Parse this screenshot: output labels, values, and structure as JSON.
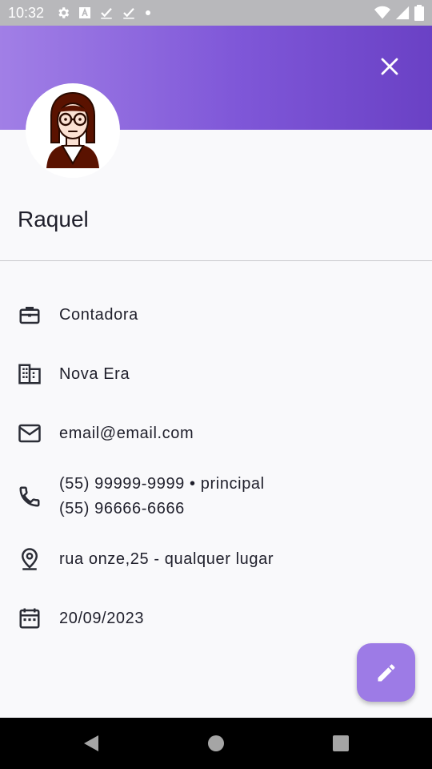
{
  "status_bar": {
    "time": "10:32",
    "background": "#b8b8bb"
  },
  "header": {
    "gradient_start": "#a17fe6",
    "gradient_end": "#6a41c5",
    "close_icon": "close-icon"
  },
  "contact": {
    "name": "Raquel",
    "job": "Contadora",
    "company": "Nova Era",
    "email": "email@email.com",
    "phone_primary": "(55) 99999-9999 • principal",
    "phone_secondary": "(55) 96666-6666",
    "address": "rua onze,25 - qualquer lugar",
    "date": "20/09/2023"
  },
  "fab": {
    "icon": "pencil-icon",
    "color": "#9d7be6"
  },
  "nav": {
    "back_icon": "back-icon",
    "home_icon": "home-icon",
    "recents_icon": "recents-icon"
  }
}
